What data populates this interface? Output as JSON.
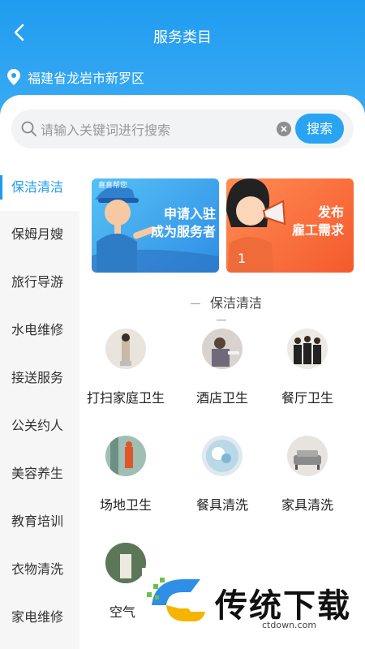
{
  "header": {
    "title": "服务类目",
    "location": "福建省龙岩市新罗区"
  },
  "search": {
    "placeholder": "请输入关键词进行搜索",
    "button": "搜索"
  },
  "sidebar": {
    "items": [
      {
        "label": "保洁清洁",
        "active": true
      },
      {
        "label": "保姆月嫂"
      },
      {
        "label": "旅行导游"
      },
      {
        "label": "水电维修"
      },
      {
        "label": "接送服务"
      },
      {
        "label": "公关约人"
      },
      {
        "label": "美容养生"
      },
      {
        "label": "教育培训"
      },
      {
        "label": "衣物清洗"
      },
      {
        "label": "家电维修"
      }
    ]
  },
  "banners": {
    "left": {
      "line1": "申请入驻",
      "line2": "成为服务者",
      "cap_text": "喜喜帮您"
    },
    "right": {
      "line1": "发布",
      "line2": "雇工需求"
    }
  },
  "section": {
    "title": "保洁清洁"
  },
  "services": [
    {
      "label": "打扫家庭卫生"
    },
    {
      "label": "酒店卫生"
    },
    {
      "label": "餐厅卫生"
    },
    {
      "label": "场地卫生"
    },
    {
      "label": "餐具清洗"
    },
    {
      "label": "家具清洗"
    },
    {
      "label": "空气"
    }
  ],
  "watermark": {
    "text": "传统下载",
    "url": "ctdown.com"
  },
  "colors": {
    "primary": "#1f9cf0",
    "orange": "#f45a2c"
  }
}
